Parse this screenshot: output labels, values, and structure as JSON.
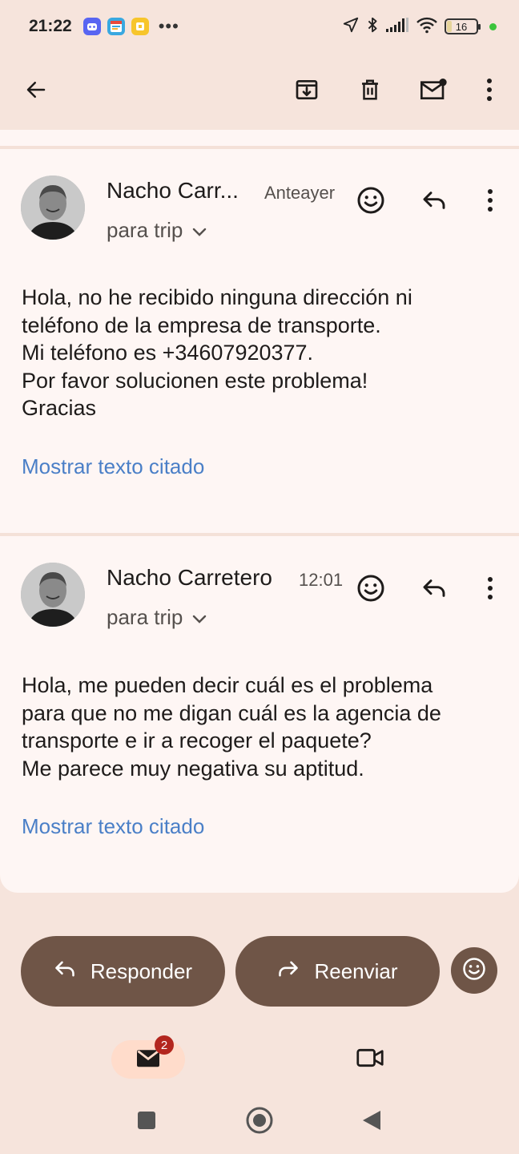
{
  "status_bar": {
    "time": "21:22",
    "notification_icons": [
      "discord-icon",
      "calendar-app-icon",
      "yellow-app-icon"
    ],
    "overflow": "•••",
    "battery_level": "16"
  },
  "toolbar": {
    "icons": [
      "back-arrow-icon",
      "archive-icon",
      "delete-icon",
      "mark-unread-icon",
      "more-vert-icon"
    ]
  },
  "messages": [
    {
      "sender": "Nacho Carr...",
      "date": "Anteayer",
      "recipient": "para trip",
      "body": [
        "Hola, no he recibido ninguna dirección ni",
        "teléfono de la empresa de transporte.",
        "Mi teléfono es +34607920377.",
        "Por favor solucionen este problema!",
        "Gracias"
      ],
      "quoted_link": "Mostrar texto citado"
    },
    {
      "sender": "Nacho Carretero",
      "date": "12:01",
      "recipient": "para trip",
      "body": [
        "Hola, me pueden decir cuál es el problema",
        "para que no me digan cuál es la agencia de",
        "transporte e ir a recoger el paquete?",
        "Me parece muy negativa su aptitud."
      ],
      "quoted_link": "Mostrar texto citado"
    }
  ],
  "actions": {
    "reply_label": "Responder",
    "forward_label": "Reenviar"
  },
  "bottom_nav": {
    "mail_badge": "2"
  },
  "colors": {
    "background": "#f6e4dc",
    "card": "#fef6f4",
    "action_button": "#6f5547",
    "link": "#4a7fc7",
    "badge": "#b3261e"
  }
}
